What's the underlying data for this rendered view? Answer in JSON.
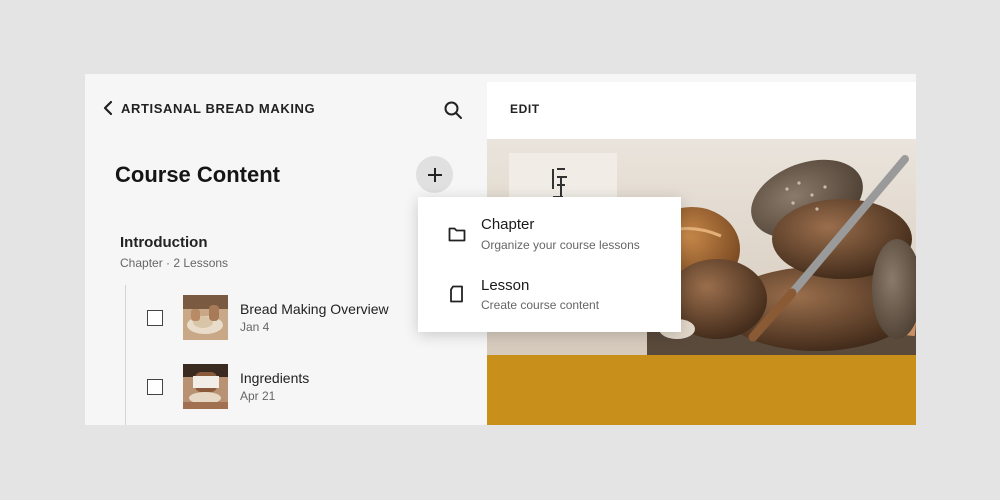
{
  "header": {
    "back_label": "ARTISANAL BREAD MAKING",
    "back_icon": "chevron-left-icon",
    "search_icon": "search-icon"
  },
  "course": {
    "title": "Course Content",
    "add_icon": "plus-icon"
  },
  "chapter": {
    "title": "Introduction",
    "meta": "Chapter · 2 Lessons"
  },
  "lessons": [
    {
      "name": "Bread Making Overview",
      "date": "Jan 4",
      "checked": false
    },
    {
      "name": "Ingredients",
      "date": "Apr 21",
      "checked": false
    }
  ],
  "editor": {
    "edit_label": "EDIT",
    "accent_color": "#c8901a"
  },
  "add_menu": {
    "items": [
      {
        "title": "Chapter",
        "description": "Organize your course lessons",
        "icon": "folder-icon"
      },
      {
        "title": "Lesson",
        "description": "Create course content",
        "icon": "document-icon"
      }
    ]
  }
}
